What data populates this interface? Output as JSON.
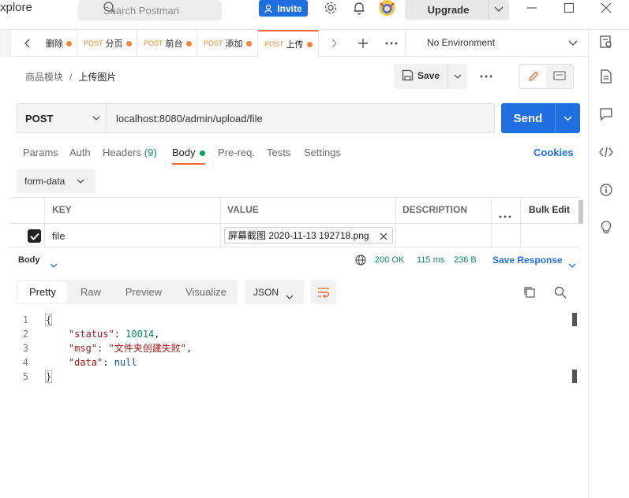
{
  "window": {
    "title_fragment": "xplore"
  },
  "topbar": {
    "search_placeholder": "Search Postman",
    "invite_label": "Invite",
    "upgrade_label": "Upgrade"
  },
  "tabs": [
    {
      "method": "",
      "label": "删除"
    },
    {
      "method": "POST",
      "label": "分页"
    },
    {
      "method": "POST",
      "label": "前台"
    },
    {
      "method": "POST",
      "label": "添加"
    },
    {
      "method": "POST",
      "label": "上传"
    }
  ],
  "environment": "No Environment",
  "breadcrumb": {
    "parent": "商品模块",
    "separator": "/",
    "current": "上传图片"
  },
  "save_label": "Save",
  "request": {
    "method": "POST",
    "url": "localhost:8080/admin/upload/file",
    "send_label": "Send"
  },
  "request_tabs": {
    "params": "Params",
    "auth": "Auth",
    "headers": "Headers",
    "headers_count": "(9)",
    "body": "Body",
    "prereq": "Pre-req.",
    "tests": "Tests",
    "settings": "Settings",
    "cookies": "Cookies"
  },
  "body_mode": "form-data",
  "kv_table": {
    "headers": {
      "key": "KEY",
      "value": "VALUE",
      "description": "DESCRIPTION",
      "bulk_edit": "Bulk Edit"
    },
    "rows": [
      {
        "checked": true,
        "key": "file",
        "value": "屏幕截图 2020-11-13 192718.png",
        "description": ""
      }
    ]
  },
  "response": {
    "section_label": "Body",
    "status": "200 OK",
    "time": "115 ms",
    "size": "236 B",
    "save_response": "Save Response",
    "view_tabs": [
      "Pretty",
      "Raw",
      "Preview",
      "Visualize"
    ],
    "format": "JSON",
    "code_lines": [
      {
        "n": "1",
        "text": "{"
      },
      {
        "n": "2",
        "key": "\"status\"",
        "val": "10014",
        "vtype": "num",
        "comma": ","
      },
      {
        "n": "3",
        "key": "\"msg\"",
        "val": "\"文件夹创建失败\"",
        "vtype": "str",
        "comma": ","
      },
      {
        "n": "4",
        "key": "\"data\"",
        "val": "null",
        "vtype": "null",
        "comma": ""
      },
      {
        "n": "5",
        "text": "}"
      }
    ]
  },
  "colors": {
    "accent": "#1f6fe0",
    "tab_marker": "#f0863a",
    "status_ok": "#0f8a5f"
  }
}
